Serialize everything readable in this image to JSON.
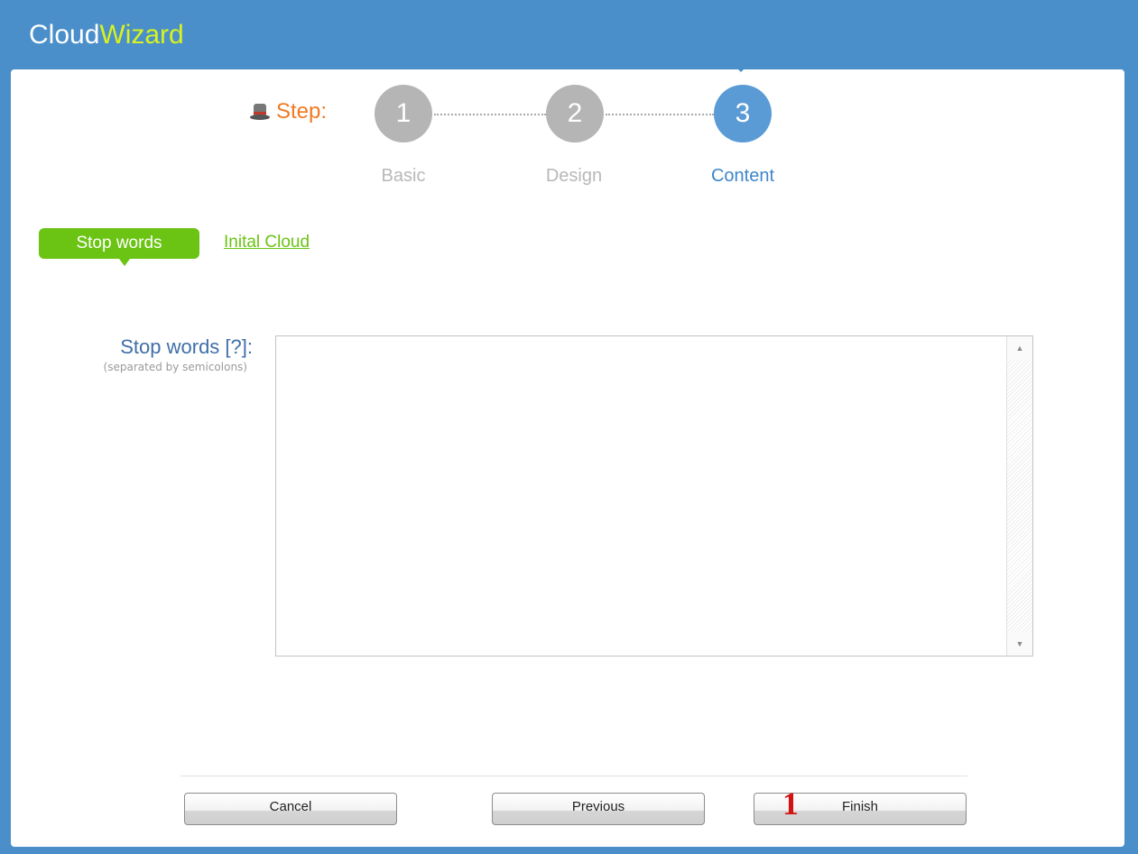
{
  "window": {
    "title_main": "Cloud",
    "title_accent": "Wizard"
  },
  "stepper": {
    "label": "Step:",
    "steps": [
      {
        "number": "1",
        "name": "Basic",
        "active": false
      },
      {
        "number": "2",
        "name": "Design",
        "active": false
      },
      {
        "number": "3",
        "name": "Content",
        "active": true
      }
    ]
  },
  "tabs": {
    "active": "Stop words",
    "other": "Inital Cloud"
  },
  "form": {
    "label": "Stop words [?]:",
    "hint": "(separated by semicolons)",
    "value": ""
  },
  "buttons": {
    "cancel": "Cancel",
    "previous": "Previous",
    "finish": "Finish"
  },
  "annotation": {
    "marker": "1"
  },
  "colors": {
    "header": "#4a8fc9",
    "accent_yellow": "#d7f21f",
    "step_orange": "#f07a23",
    "step_active": "#5a9bd6",
    "step_inactive": "#b5b5b5",
    "tab_green": "#6bc313",
    "marker_red": "#d41212"
  }
}
